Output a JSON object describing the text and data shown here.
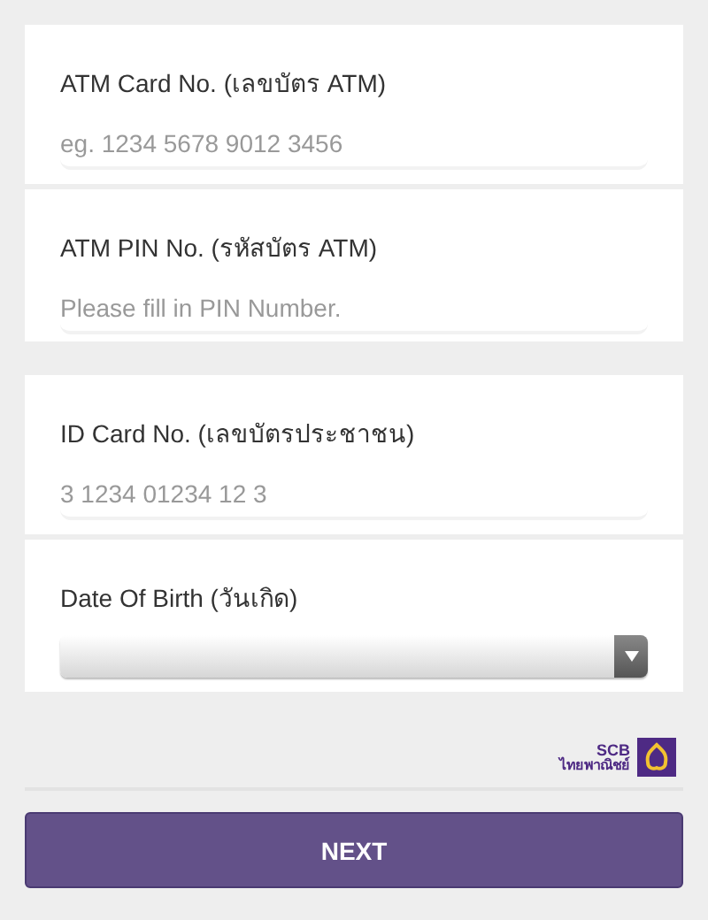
{
  "sections": [
    {
      "fields": [
        {
          "kind": "text",
          "label": "ATM Card No. (เลขบัตร ATM)",
          "placeholder": "eg. 1234 5678 9012 3456"
        },
        {
          "kind": "text",
          "label": "ATM PIN No. (รหัสบัตร ATM)",
          "placeholder": "Please fill in PIN Number."
        }
      ]
    },
    {
      "fields": [
        {
          "kind": "text",
          "label": "ID Card No. (เลขบัตรประชาชน)",
          "placeholder": "3 1234 01234 12 3"
        },
        {
          "kind": "select",
          "label": "Date Of Birth (วันเกิด)"
        }
      ]
    }
  ],
  "logo": {
    "name": "SCB",
    "subtitle": "ไทยพาณิชย์"
  },
  "next_button": "NEXT"
}
